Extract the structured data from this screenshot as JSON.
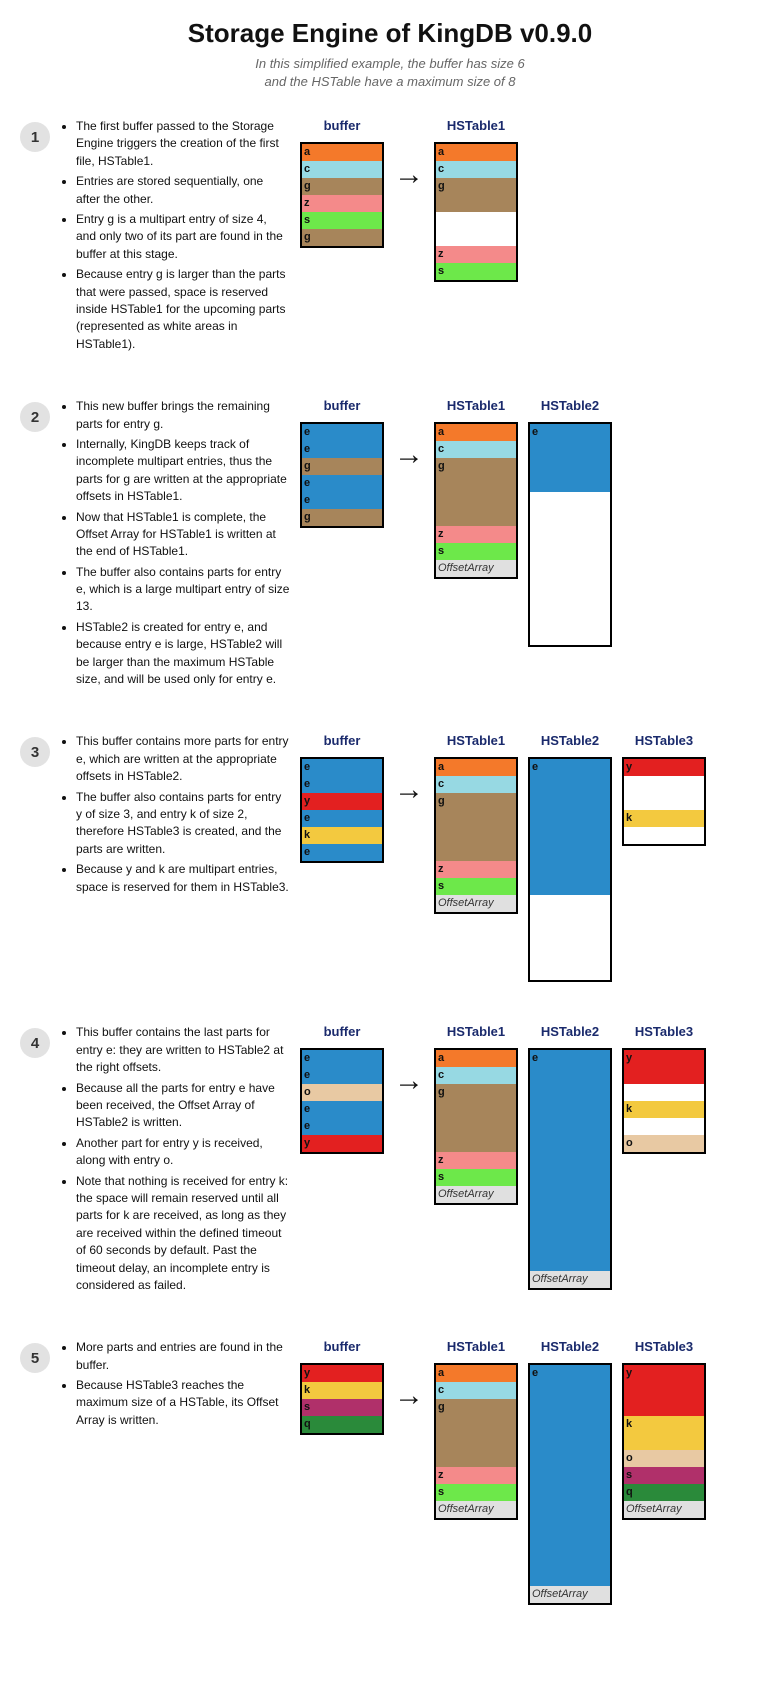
{
  "title": "Storage Engine of KingDB v0.9.0",
  "subtitle_l1": "In this simplified example, the buffer has size 6",
  "subtitle_l2": "and the HSTable have a maximum size of 8",
  "labels": {
    "buffer": "buffer",
    "hstable1": "HSTable1",
    "hstable2": "HSTable2",
    "hstable3": "HSTable3",
    "offset": "OffsetArray",
    "arrow": "→"
  },
  "colors": {
    "a": "#f4792a",
    "c": "#97d9e3",
    "g": "#a7855b",
    "z": "#f48a8a",
    "s": "#6de84a",
    "e": "#2a8bc9",
    "y": "#e32020",
    "k": "#f3c93f",
    "o": "#e8c9a3",
    "q": "#2a8a3a",
    "white": "#ffffff",
    "offset": "#e0e0e0"
  },
  "steps": [
    {
      "n": "1",
      "bullets": [
        "The first buffer passed to the Storage Engine triggers the creation of the first file, HSTable1.",
        "Entries are stored sequentially, one after the other.",
        "Entry g is a multipart entry of size 4, and only two of its part are found in the buffer at this stage.",
        "Because entry g is larger than the parts that were passed, space is reserved inside HSTable1 for the upcoming parts (represented as white areas in HSTable1)."
      ],
      "tables": {
        "buffer": [
          [
            "a",
            "a"
          ],
          [
            "c",
            "c"
          ],
          [
            "g",
            "g"
          ],
          [
            "z",
            "z"
          ],
          [
            "s",
            "s"
          ],
          [
            "g",
            "g"
          ]
        ],
        "hstable1": [
          [
            "a",
            "a"
          ],
          [
            "c",
            "c"
          ],
          [
            "g",
            "g"
          ],
          [
            "",
            "g"
          ],
          [
            "",
            "white"
          ],
          [
            "",
            "white"
          ],
          [
            "z",
            "z"
          ],
          [
            "s",
            "s"
          ]
        ]
      }
    },
    {
      "n": "2",
      "bullets": [
        "This new buffer brings the remaining parts for entry g.",
        "Internally, KingDB keeps track of incomplete multipart entries, thus the parts for g are written at the appropriate offsets in HSTable1.",
        "Now that HSTable1 is complete, the Offset Array for HSTable1 is written at the end of HSTable1.",
        "The buffer also contains parts for entry e, which is a large multipart entry of size 13.",
        "HSTable2 is created for entry e, and because entry e is large, HSTable2 will be larger than the maximum HSTable size, and will be used only for entry e."
      ],
      "tables": {
        "buffer": [
          [
            "e",
            "e"
          ],
          [
            "e",
            "e"
          ],
          [
            "g",
            "g"
          ],
          [
            "e",
            "e"
          ],
          [
            "e",
            "e"
          ],
          [
            "g",
            "g"
          ]
        ],
        "hstable1": [
          [
            "a",
            "a"
          ],
          [
            "c",
            "c"
          ],
          [
            "g",
            "g"
          ],
          [
            "",
            "g"
          ],
          [
            "",
            "g"
          ],
          [
            "",
            "g"
          ],
          [
            "z",
            "z"
          ],
          [
            "s",
            "s"
          ],
          [
            "OffsetArray",
            "offset"
          ]
        ],
        "hstable2": [
          [
            "e",
            "e"
          ],
          [
            "",
            "e"
          ],
          [
            "",
            "e"
          ],
          [
            "",
            "e"
          ],
          [
            "",
            "white"
          ],
          [
            "",
            "white"
          ],
          [
            "",
            "white"
          ],
          [
            "",
            "white"
          ],
          [
            "",
            "white"
          ],
          [
            "",
            "white"
          ],
          [
            "",
            "white"
          ],
          [
            "",
            "white"
          ],
          [
            "",
            "white"
          ]
        ]
      }
    },
    {
      "n": "3",
      "bullets": [
        "This buffer contains more parts for entry e, which are written at the appropriate offsets in HSTable2.",
        "The buffer also contains parts for entry y of size 3, and entry k of size 2, therefore HSTable3 is created, and the parts are written.",
        "Because y and k are multipart entries, space is reserved for them in HSTable3."
      ],
      "tables": {
        "buffer": [
          [
            "e",
            "e"
          ],
          [
            "e",
            "e"
          ],
          [
            "y",
            "y"
          ],
          [
            "e",
            "e"
          ],
          [
            "k",
            "k"
          ],
          [
            "e",
            "e"
          ]
        ],
        "hstable1": [
          [
            "a",
            "a"
          ],
          [
            "c",
            "c"
          ],
          [
            "g",
            "g"
          ],
          [
            "",
            "g"
          ],
          [
            "",
            "g"
          ],
          [
            "",
            "g"
          ],
          [
            "z",
            "z"
          ],
          [
            "s",
            "s"
          ],
          [
            "OffsetArray",
            "offset"
          ]
        ],
        "hstable2": [
          [
            "e",
            "e"
          ],
          [
            "",
            "e"
          ],
          [
            "",
            "e"
          ],
          [
            "",
            "e"
          ],
          [
            "",
            "e"
          ],
          [
            "",
            "e"
          ],
          [
            "",
            "e"
          ],
          [
            "",
            "e"
          ],
          [
            "",
            "white"
          ],
          [
            "",
            "white"
          ],
          [
            "",
            "white"
          ],
          [
            "",
            "white"
          ],
          [
            "",
            "white"
          ]
        ],
        "hstable3": [
          [
            "y",
            "y"
          ],
          [
            "",
            "white"
          ],
          [
            "",
            "white"
          ],
          [
            "k",
            "k"
          ],
          [
            "",
            "white"
          ]
        ]
      }
    },
    {
      "n": "4",
      "bullets": [
        "This buffer contains the last parts for entry e: they are written to HSTable2 at the right offsets.",
        "Because all the parts for entry e have been received, the Offset Array of HSTable2 is written.",
        "Another part for entry y is received, along with entry o.",
        "Note that nothing is received for entry k: the space will remain reserved until all parts for k are received, as long as they are received within the defined timeout of 60 seconds by default. Past the timeout delay, an incomplete entry is considered as failed."
      ],
      "tables": {
        "buffer": [
          [
            "e",
            "e"
          ],
          [
            "e",
            "e"
          ],
          [
            "o",
            "o"
          ],
          [
            "e",
            "e"
          ],
          [
            "e",
            "e"
          ],
          [
            "y",
            "y"
          ]
        ],
        "hstable1": [
          [
            "a",
            "a"
          ],
          [
            "c",
            "c"
          ],
          [
            "g",
            "g"
          ],
          [
            "",
            "g"
          ],
          [
            "",
            "g"
          ],
          [
            "",
            "g"
          ],
          [
            "z",
            "z"
          ],
          [
            "s",
            "s"
          ],
          [
            "OffsetArray",
            "offset"
          ]
        ],
        "hstable2": [
          [
            "e",
            "e"
          ],
          [
            "",
            "e"
          ],
          [
            "",
            "e"
          ],
          [
            "",
            "e"
          ],
          [
            "",
            "e"
          ],
          [
            "",
            "e"
          ],
          [
            "",
            "e"
          ],
          [
            "",
            "e"
          ],
          [
            "",
            "e"
          ],
          [
            "",
            "e"
          ],
          [
            "",
            "e"
          ],
          [
            "",
            "e"
          ],
          [
            "",
            "e"
          ],
          [
            "OffsetArray",
            "offset"
          ]
        ],
        "hstable3": [
          [
            "y",
            "y"
          ],
          [
            "",
            "y"
          ],
          [
            "",
            "white"
          ],
          [
            "k",
            "k"
          ],
          [
            "",
            "white"
          ],
          [
            "o",
            "o"
          ]
        ]
      }
    },
    {
      "n": "5",
      "bullets": [
        "More parts and entries are found in the buffer.",
        "Because HSTable3 reaches the maximum size of a HSTable, its Offset Array is written."
      ],
      "tables": {
        "buffer": [
          [
            "y",
            "y"
          ],
          [
            "k",
            "k"
          ],
          [
            "s",
            "m"
          ],
          [
            "q",
            "q"
          ]
        ],
        "hstable1": [
          [
            "a",
            "a"
          ],
          [
            "c",
            "c"
          ],
          [
            "g",
            "g"
          ],
          [
            "",
            "g"
          ],
          [
            "",
            "g"
          ],
          [
            "",
            "g"
          ],
          [
            "z",
            "z"
          ],
          [
            "s",
            "s"
          ],
          [
            "OffsetArray",
            "offset"
          ]
        ],
        "hstable2": [
          [
            "e",
            "e"
          ],
          [
            "",
            "e"
          ],
          [
            "",
            "e"
          ],
          [
            "",
            "e"
          ],
          [
            "",
            "e"
          ],
          [
            "",
            "e"
          ],
          [
            "",
            "e"
          ],
          [
            "",
            "e"
          ],
          [
            "",
            "e"
          ],
          [
            "",
            "e"
          ],
          [
            "",
            "e"
          ],
          [
            "",
            "e"
          ],
          [
            "",
            "e"
          ],
          [
            "OffsetArray",
            "offset"
          ]
        ],
        "hstable3": [
          [
            "y",
            "y"
          ],
          [
            "",
            "y"
          ],
          [
            "",
            "y"
          ],
          [
            "k",
            "k"
          ],
          [
            "",
            "k"
          ],
          [
            "o",
            "o"
          ],
          [
            "s",
            "m"
          ],
          [
            "q",
            "q"
          ],
          [
            "OffsetArray",
            "offset"
          ]
        ]
      }
    }
  ]
}
